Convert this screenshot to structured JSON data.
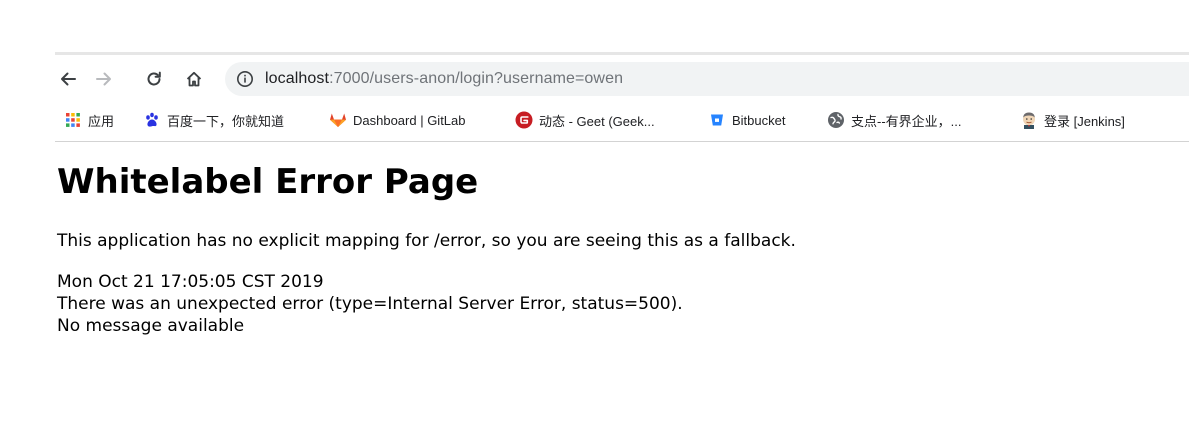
{
  "browser": {
    "url_host": "localhost",
    "url_path": ":7000/users-anon/login?username=owen",
    "bookmarks": [
      {
        "label": "应用",
        "icon": "apps-grid-icon"
      },
      {
        "label": "百度一下，你就知道",
        "icon": "baidu-paw-icon"
      },
      {
        "label": "Dashboard | GitLab",
        "icon": "gitlab-fox-icon"
      },
      {
        "label": "动态 - Geet (Geek...",
        "icon": "gitee-g-icon"
      },
      {
        "label": "Bitbucket",
        "icon": "bitbucket-icon"
      },
      {
        "label": "支点--有界企业，...",
        "icon": "globe-icon"
      },
      {
        "label": "登录 [Jenkins]",
        "icon": "jenkins-icon"
      }
    ]
  },
  "page": {
    "title": "Whitelabel Error Page",
    "lead": "This application has no explicit mapping for /error, so you are seeing this as a fallback.",
    "timestamp": "Mon Oct 21 17:05:05 CST 2019",
    "error_line": "There was an unexpected error (type=Internal Server Error, status=500).",
    "message": "No message available"
  },
  "colors": {
    "omnibox_bg": "#f1f3f4",
    "url_path": "#6f7378",
    "gitlab_orange": "#e24329",
    "gitee_red": "#c71d23",
    "bitbucket_blue": "#2684ff",
    "baidu_blue": "#2932e1"
  }
}
